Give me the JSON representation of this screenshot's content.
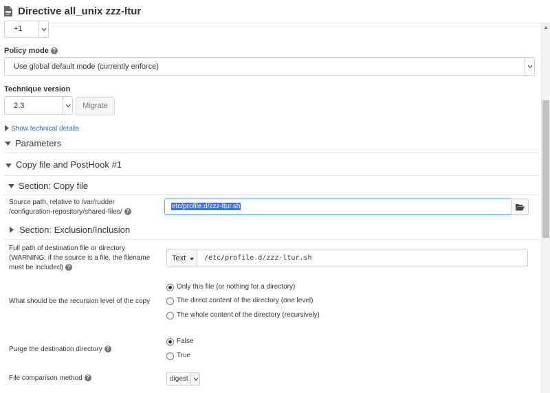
{
  "header": {
    "title": "Directive all_unix zzz-ltur"
  },
  "priority": {
    "value": "+1"
  },
  "policy_mode": {
    "label": "Policy mode",
    "value": "Use global default mode (currently enforce)"
  },
  "technique_version": {
    "label": "Technique version",
    "value": "2.3",
    "migrate_label": "Migrate"
  },
  "technical_details_link": "Show technical details",
  "parameters": {
    "title": "Parameters",
    "block_title": "Copy file and PostHook #1",
    "section_copy": "Section: Copy file",
    "source_path": {
      "label_1": "Source path, relative to /var/rudder",
      "label_2": "/configuration-repository/shared-files/",
      "value": "etc/profile.d/zzz-ltur.sh"
    },
    "section_exclusion": "Section: Exclusion/Inclusion",
    "destination": {
      "label_1": "Full path of destination file or directory",
      "label_2": "(WARNING: if the source is a file, the filename",
      "label_3": "must be included)",
      "type_label": "Text",
      "value": "/etc/profile.d/zzz-ltur.sh"
    },
    "recursion": {
      "label": "What should be the recursion level of the copy",
      "options": [
        "Only this file (or nothing for a directory)",
        "The direct content of the directory (one level)",
        "The whole content of the directory (recursively)"
      ],
      "selected_index": 0
    },
    "purge": {
      "label": "Purge the destination directory",
      "options": [
        "False",
        "True"
      ],
      "selected_index": 0
    },
    "comparison": {
      "label": "File comparison method",
      "value": "digest"
    }
  },
  "icons": {
    "help": "question-circle-icon",
    "folder": "folder-open-icon",
    "document": "file-icon"
  },
  "colors": {
    "link": "#2a6ebb",
    "selection": "#3b73d6"
  }
}
